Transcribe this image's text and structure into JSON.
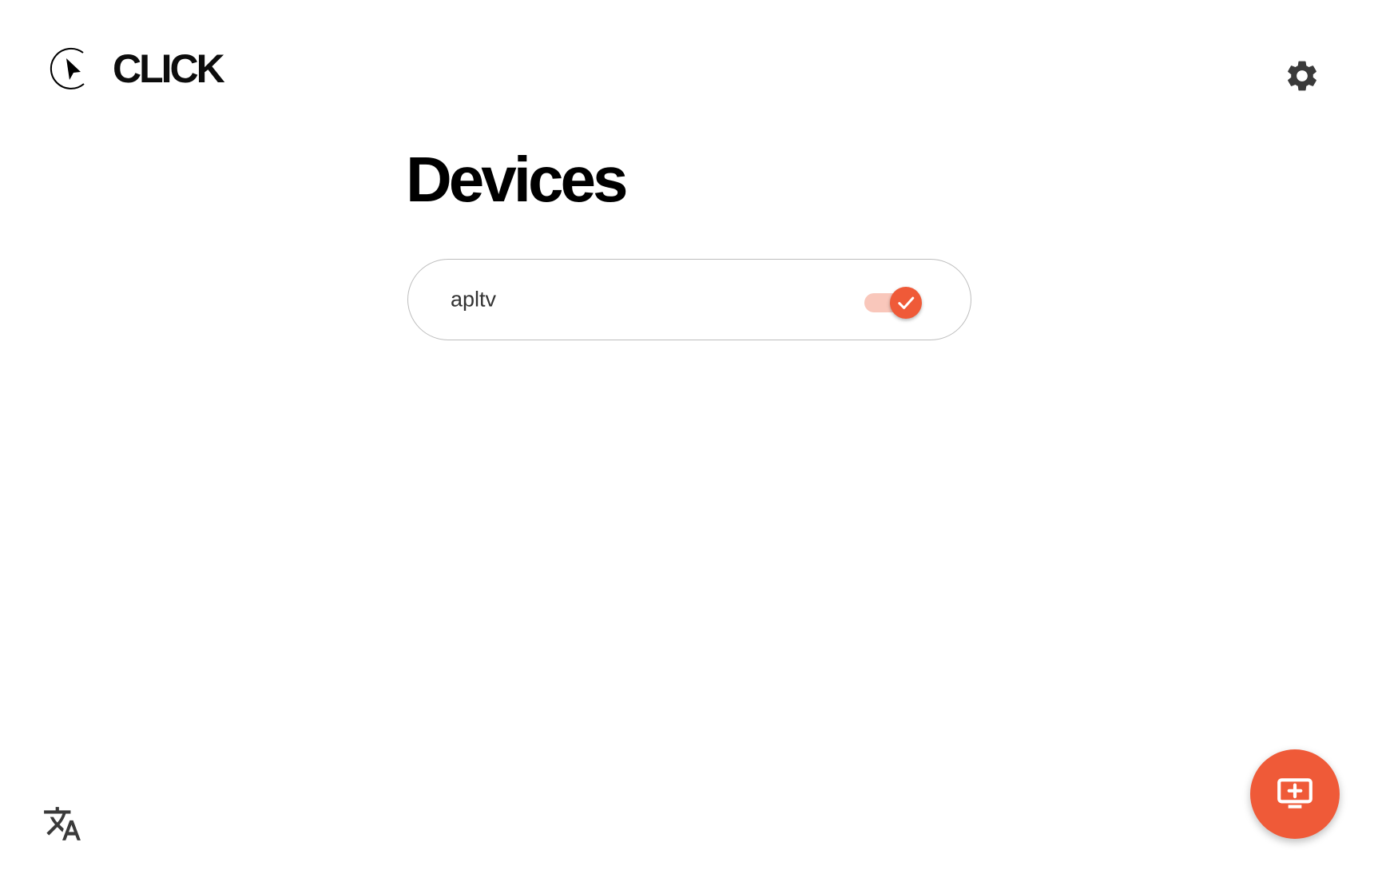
{
  "brand": {
    "name": "CLICK",
    "logo_icon": "cursor-play-circle-icon"
  },
  "header": {
    "settings_icon": "gear-icon"
  },
  "main": {
    "title": "Devices",
    "devices": [
      {
        "name": "apltv",
        "enabled": true
      }
    ]
  },
  "footer": {
    "language_icon": "translate-icon",
    "add_device_icon": "add-to-screen-icon"
  },
  "colors": {
    "accent": "#ef5a38",
    "accent_light": "#f9c7bb",
    "text": "#333333",
    "border": "#bdbdbd"
  }
}
